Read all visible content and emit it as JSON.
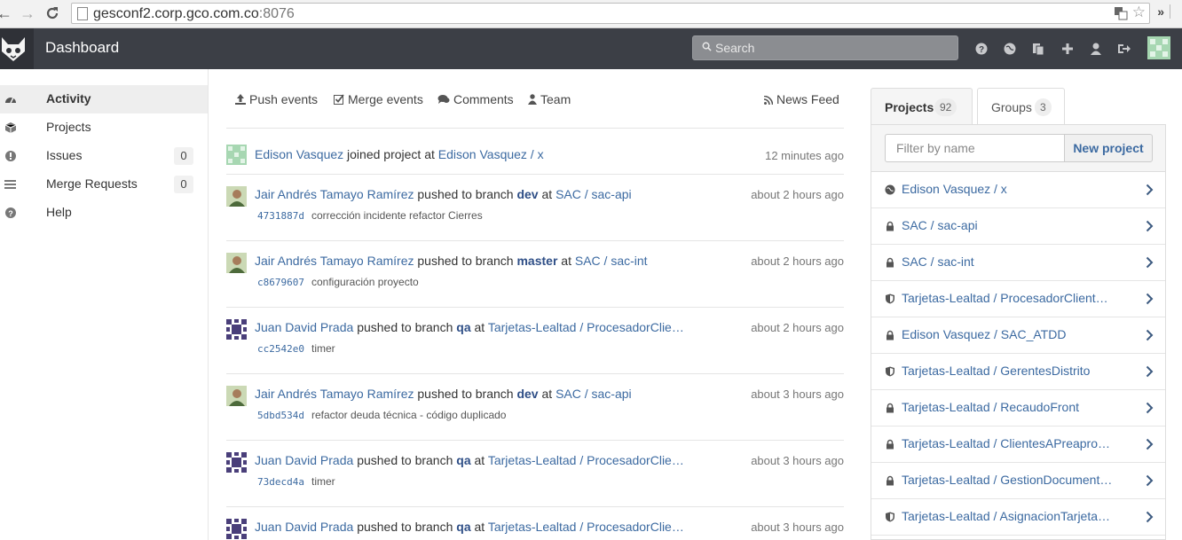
{
  "browser": {
    "url_host": "gesconf2.corp.gco.com.co",
    "url_port": ":8076"
  },
  "header": {
    "title": "Dashboard",
    "search_placeholder": "Search"
  },
  "sidebar": {
    "items": [
      {
        "label": "Activity",
        "icon": "dashboard-icon",
        "active": true
      },
      {
        "label": "Projects",
        "icon": "cube-icon"
      },
      {
        "label": "Issues",
        "icon": "exclamation-circle-icon",
        "count": "0"
      },
      {
        "label": "Merge Requests",
        "icon": "list-icon",
        "count": "0"
      },
      {
        "label": "Help",
        "icon": "question-circle-icon"
      }
    ]
  },
  "filters": {
    "push": "Push events",
    "merge": "Merge events",
    "comments": "Comments",
    "team": "Team",
    "news_feed": "News Feed"
  },
  "events": [
    {
      "author": "Edison Vasquez",
      "action": "joined project",
      "at": "at",
      "project": "Edison Vasquez / x",
      "time": "12 minutes ago"
    },
    {
      "author": "Jair Andrés Tamayo Ramírez",
      "action": "pushed to branch",
      "branch": "dev",
      "at": "at",
      "project": "SAC / sac-api",
      "time": "about 2 hours ago",
      "sha": "4731887d",
      "message": "corrección incidente refactor Cierres"
    },
    {
      "author": "Jair Andrés Tamayo Ramírez",
      "action": "pushed to branch",
      "branch": "master",
      "at": "at",
      "project": "SAC / sac-int",
      "time": "about 2 hours ago",
      "sha": "c8679607",
      "message": "configuración proyecto"
    },
    {
      "author": "Juan David Prada",
      "action": "pushed to branch",
      "branch": "qa",
      "at": "at",
      "project": "Tarjetas-Lealtad / ProcesadorClie…",
      "time": "about 2 hours ago",
      "sha": "cc2542e0",
      "message": "timer"
    },
    {
      "author": "Jair Andrés Tamayo Ramírez",
      "action": "pushed to branch",
      "branch": "dev",
      "at": "at",
      "project": "SAC / sac-api",
      "time": "about 3 hours ago",
      "sha": "5dbd534d",
      "message": "refactor deuda técnica - código duplicado"
    },
    {
      "author": "Juan David Prada",
      "action": "pushed to branch",
      "branch": "qa",
      "at": "at",
      "project": "Tarjetas-Lealtad / ProcesadorClie…",
      "time": "about 3 hours ago",
      "sha": "73decd4a",
      "message": "timer"
    },
    {
      "author": "Juan David Prada",
      "action": "pushed to branch",
      "branch": "qa",
      "at": "at",
      "project": "Tarjetas-Lealtad / ProcesadorClie…",
      "time": "about 3 hours ago"
    }
  ],
  "right_panel": {
    "tabs": [
      {
        "label": "Projects",
        "count": "92",
        "active": true
      },
      {
        "label": "Groups",
        "count": "3"
      }
    ],
    "filter_placeholder": "Filter by name",
    "new_project": "New project",
    "projects": [
      {
        "name": "Edison Vasquez / x",
        "visibility": "globe-icon"
      },
      {
        "name": "SAC / sac-api",
        "visibility": "lock-icon"
      },
      {
        "name": "SAC / sac-int",
        "visibility": "lock-icon"
      },
      {
        "name": "Tarjetas-Lealtad / ProcesadorClient…",
        "visibility": "shield-icon"
      },
      {
        "name": "Edison Vasquez / SAC_ATDD",
        "visibility": "lock-icon"
      },
      {
        "name": "Tarjetas-Lealtad / GerentesDistrito",
        "visibility": "shield-icon"
      },
      {
        "name": "Tarjetas-Lealtad / RecaudoFront",
        "visibility": "lock-icon"
      },
      {
        "name": "Tarjetas-Lealtad / ClientesAPreapro…",
        "visibility": "lock-icon"
      },
      {
        "name": "Tarjetas-Lealtad / GestionDocument…",
        "visibility": "lock-icon"
      },
      {
        "name": "Tarjetas-Lealtad / AsignacionTarjeta…",
        "visibility": "shield-icon"
      }
    ]
  }
}
